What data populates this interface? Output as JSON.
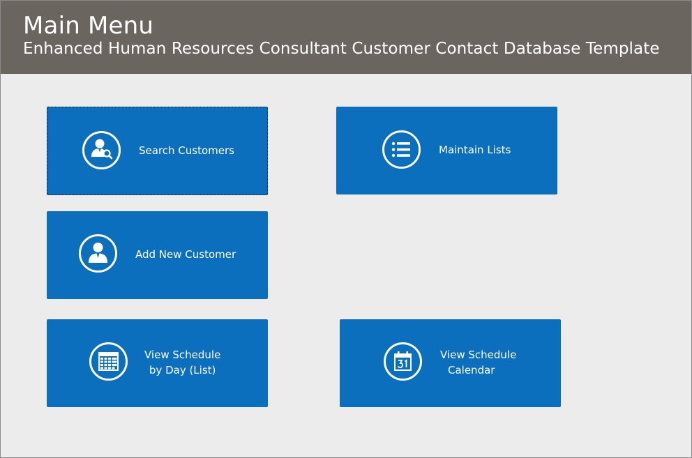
{
  "header": {
    "title": "Main Menu",
    "subtitle": "Enhanced Human Resources Consultant Customer Contact Database Template"
  },
  "tiles": {
    "search_customers": {
      "label": "Search Customers",
      "icon": "person-search-icon"
    },
    "maintain_lists": {
      "label": "Maintain Lists",
      "icon": "list-icon"
    },
    "add_new_customer": {
      "label": "Add New Customer",
      "icon": "person-icon"
    },
    "view_schedule_day": {
      "line1": "View Schedule",
      "line2": "by Day (List)",
      "icon": "calendar-grid-icon"
    },
    "view_schedule_calendar": {
      "line1": "View Schedule",
      "line2": "Calendar",
      "icon": "calendar-31-icon"
    }
  },
  "colors": {
    "header_bg": "#6b6560",
    "tile_bg": "#0b6fbe",
    "page_bg": "#ececec"
  }
}
